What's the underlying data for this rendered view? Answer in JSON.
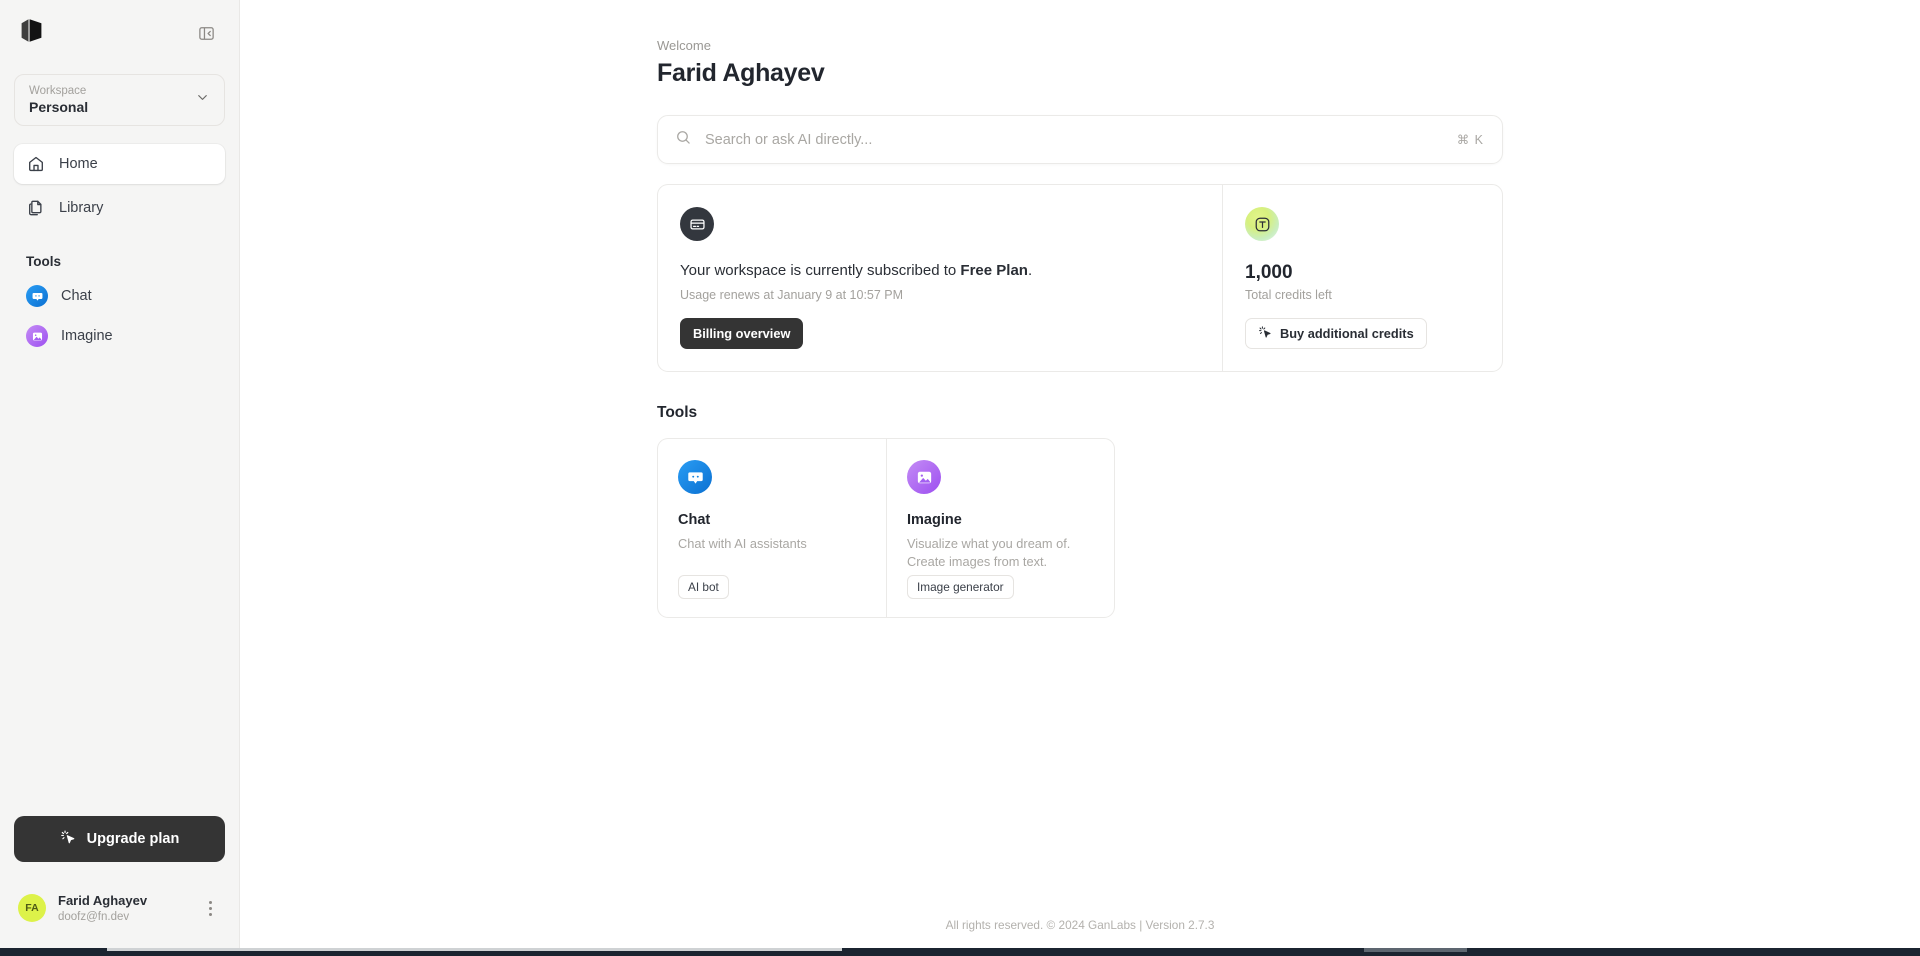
{
  "sidebar": {
    "logo_name": "ganlabs-logo",
    "collapse_icon": "panel-collapse-left-icon",
    "workspace": {
      "label": "Workspace",
      "value": "Personal",
      "chevron_icon": "chevron-down-icon"
    },
    "nav": [
      {
        "label": "Home",
        "icon": "home-icon",
        "active": true
      },
      {
        "label": "Library",
        "icon": "library-icon",
        "active": false
      }
    ],
    "tools_heading": "Tools",
    "tools": [
      {
        "label": "Chat",
        "icon": "chat-bot-icon"
      },
      {
        "label": "Imagine",
        "icon": "image-icon"
      }
    ],
    "upgrade": {
      "label": "Upgrade plan",
      "icon": "sparkle-cursor-icon"
    },
    "user": {
      "initials": "FA",
      "name": "Farid Aghayev",
      "email": "doofz@fn.dev",
      "menu_icon": "kebab-menu-icon"
    }
  },
  "main": {
    "welcome_label": "Welcome",
    "user_name": "Farid Aghayev",
    "search": {
      "placeholder": "Search or ask AI directly...",
      "value": "",
      "shortcut": "⌘ K",
      "icon": "search-icon"
    },
    "billing_card": {
      "icon": "credit-card-icon",
      "text_before": "Your workspace is currently subscribed to ",
      "plan_name": "Free Plan",
      "text_after": ".",
      "renew_text": "Usage renews at January 9 at 10:57 PM",
      "button_label": "Billing overview"
    },
    "credits_card": {
      "icon": "token-t-icon",
      "value": "1,000",
      "label": "Total credits left",
      "button_label": "Buy additional credits",
      "button_icon": "sparkle-cursor-icon"
    },
    "tools_heading": "Tools",
    "tool_cards": [
      {
        "title": "Chat",
        "description": "Chat with AI assistants",
        "tag": "AI bot",
        "icon": "chat-bot-icon",
        "accent": "#0b70d1"
      },
      {
        "title": "Imagine",
        "description": "Visualize what you dream of. Create images from text.",
        "tag": "Image generator",
        "icon": "image-icon",
        "accent": "#9d4ff0"
      }
    ],
    "footer": "All rights reserved. © 2024 GanLabs | Version 2.7.3"
  }
}
